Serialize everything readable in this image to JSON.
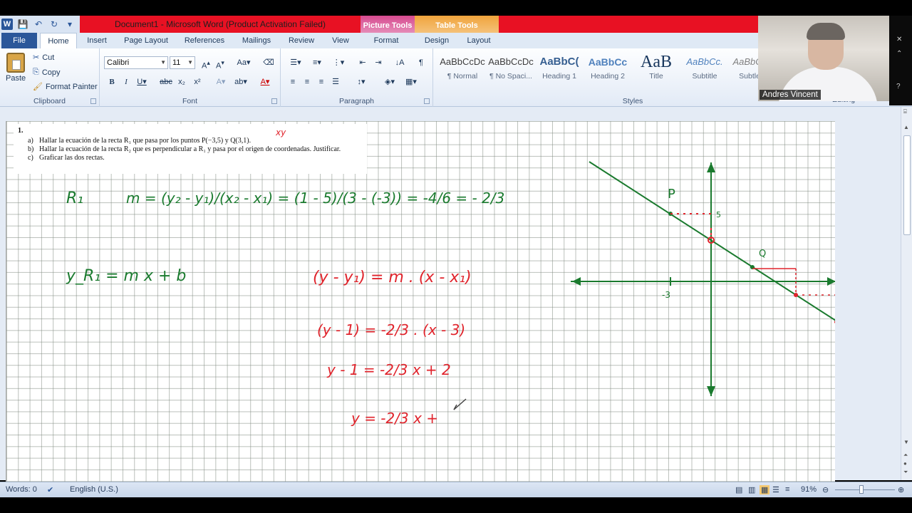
{
  "window": {
    "title": "Document1 - Microsoft Word (Product Activation Failed)"
  },
  "context_tabs": {
    "picture_tools": "Picture Tools",
    "table_tools": "Table Tools"
  },
  "tabs": [
    "File",
    "Home",
    "Insert",
    "Page Layout",
    "References",
    "Mailings",
    "Review",
    "View",
    "Format",
    "Design",
    "Layout"
  ],
  "clipboard": {
    "paste": "Paste",
    "cut": "Cut",
    "copy": "Copy",
    "format_painter": "Format Painter",
    "label": "Clipboard"
  },
  "font": {
    "name": "Calibri",
    "size": "11",
    "label": "Font"
  },
  "paragraph": {
    "label": "Paragraph"
  },
  "styles": {
    "label": "Styles",
    "items": [
      {
        "preview": "AaBbCcDc",
        "name": "¶ Normal"
      },
      {
        "preview": "AaBbCcDc",
        "name": "¶ No Spaci..."
      },
      {
        "preview": "AaBbC(",
        "name": "Heading 1"
      },
      {
        "preview": "AaBbCc",
        "name": "Heading 2"
      },
      {
        "preview": "AaB",
        "name": "Title"
      },
      {
        "preview": "AaBbCc.",
        "name": "Subtitle"
      },
      {
        "preview": "AaBbCcD",
        "name": "Subtle E"
      }
    ]
  },
  "editing": {
    "label": "Editing"
  },
  "webcam": {
    "name": "Andres Vincent"
  },
  "problem": {
    "number": "1.",
    "items": [
      {
        "letter": "a)",
        "text": "Hallar la ecuación de la recta R₁ que pasa por los puntos P(−3,5) y Q(3,1)."
      },
      {
        "letter": "b)",
        "text": "Hallar la ecuación de la recta R₂ que es perpendicular a R₁ y pasa por el origen de coordenadas. Justificar."
      },
      {
        "letter": "c)",
        "text": "Graficar las dos rectas."
      }
    ]
  },
  "handwriting": {
    "xy_note": "xy",
    "r1_label": "R₁",
    "slope_eq": "m = (y₂ - y₁)/(x₂ - x₁) = (1 - 5)/(3 - (-3)) = -4/6 = - 2/3",
    "point_slope": "(y - y₁) = m . (x - x₁)",
    "substituted": "(y - 1) = -2/3 . (x - 3)",
    "expanded": "y - 1 = -2/3 x + 2",
    "partial": "y = -2/3 x +",
    "y_eq": "y_R₁ = m x + b",
    "graph_labels": {
      "p": "P",
      "q": "Q",
      "neg3": "-3",
      "five": "5"
    }
  },
  "status": {
    "words": "Words: 0",
    "language": "English (U.S.)",
    "zoom": "91%"
  },
  "colors": {
    "title_bar": "#e81123",
    "file_tab": "#2b579a",
    "green_ink": "#1a7a2e",
    "red_ink": "#e0242c"
  }
}
